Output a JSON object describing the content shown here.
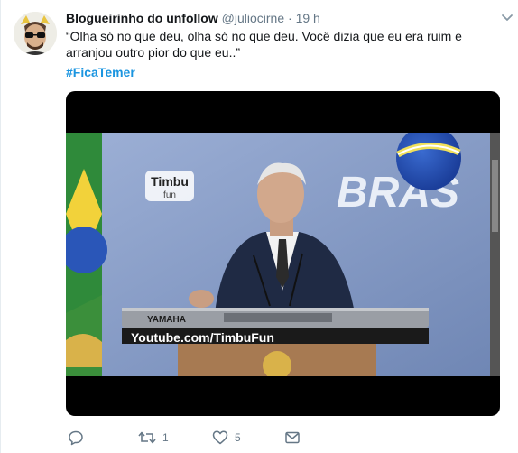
{
  "tweet": {
    "author_name": "Blogueirinho do unfollow",
    "author_handle": "@juliocirne",
    "separator": "·",
    "time": "19 h",
    "text": "“Olha só no que deu, olha só no que deu. Você dizia que eu era ruim e arranjou outro pior do que eu..”",
    "hashtag": "#FicaTemer"
  },
  "video": {
    "badge_top": "Timbu",
    "badge_bottom": "fun",
    "backdrop_word": "BRAS",
    "keyboard_brand": "YAMAHA",
    "watermark": "Youtube.com/TimbuFun"
  },
  "actions": {
    "reply_count": "",
    "retweet_count": "1",
    "like_count": "5"
  },
  "colors": {
    "link": "#1b95e0",
    "secondary_text": "#657786",
    "primary_text": "#14171a"
  }
}
